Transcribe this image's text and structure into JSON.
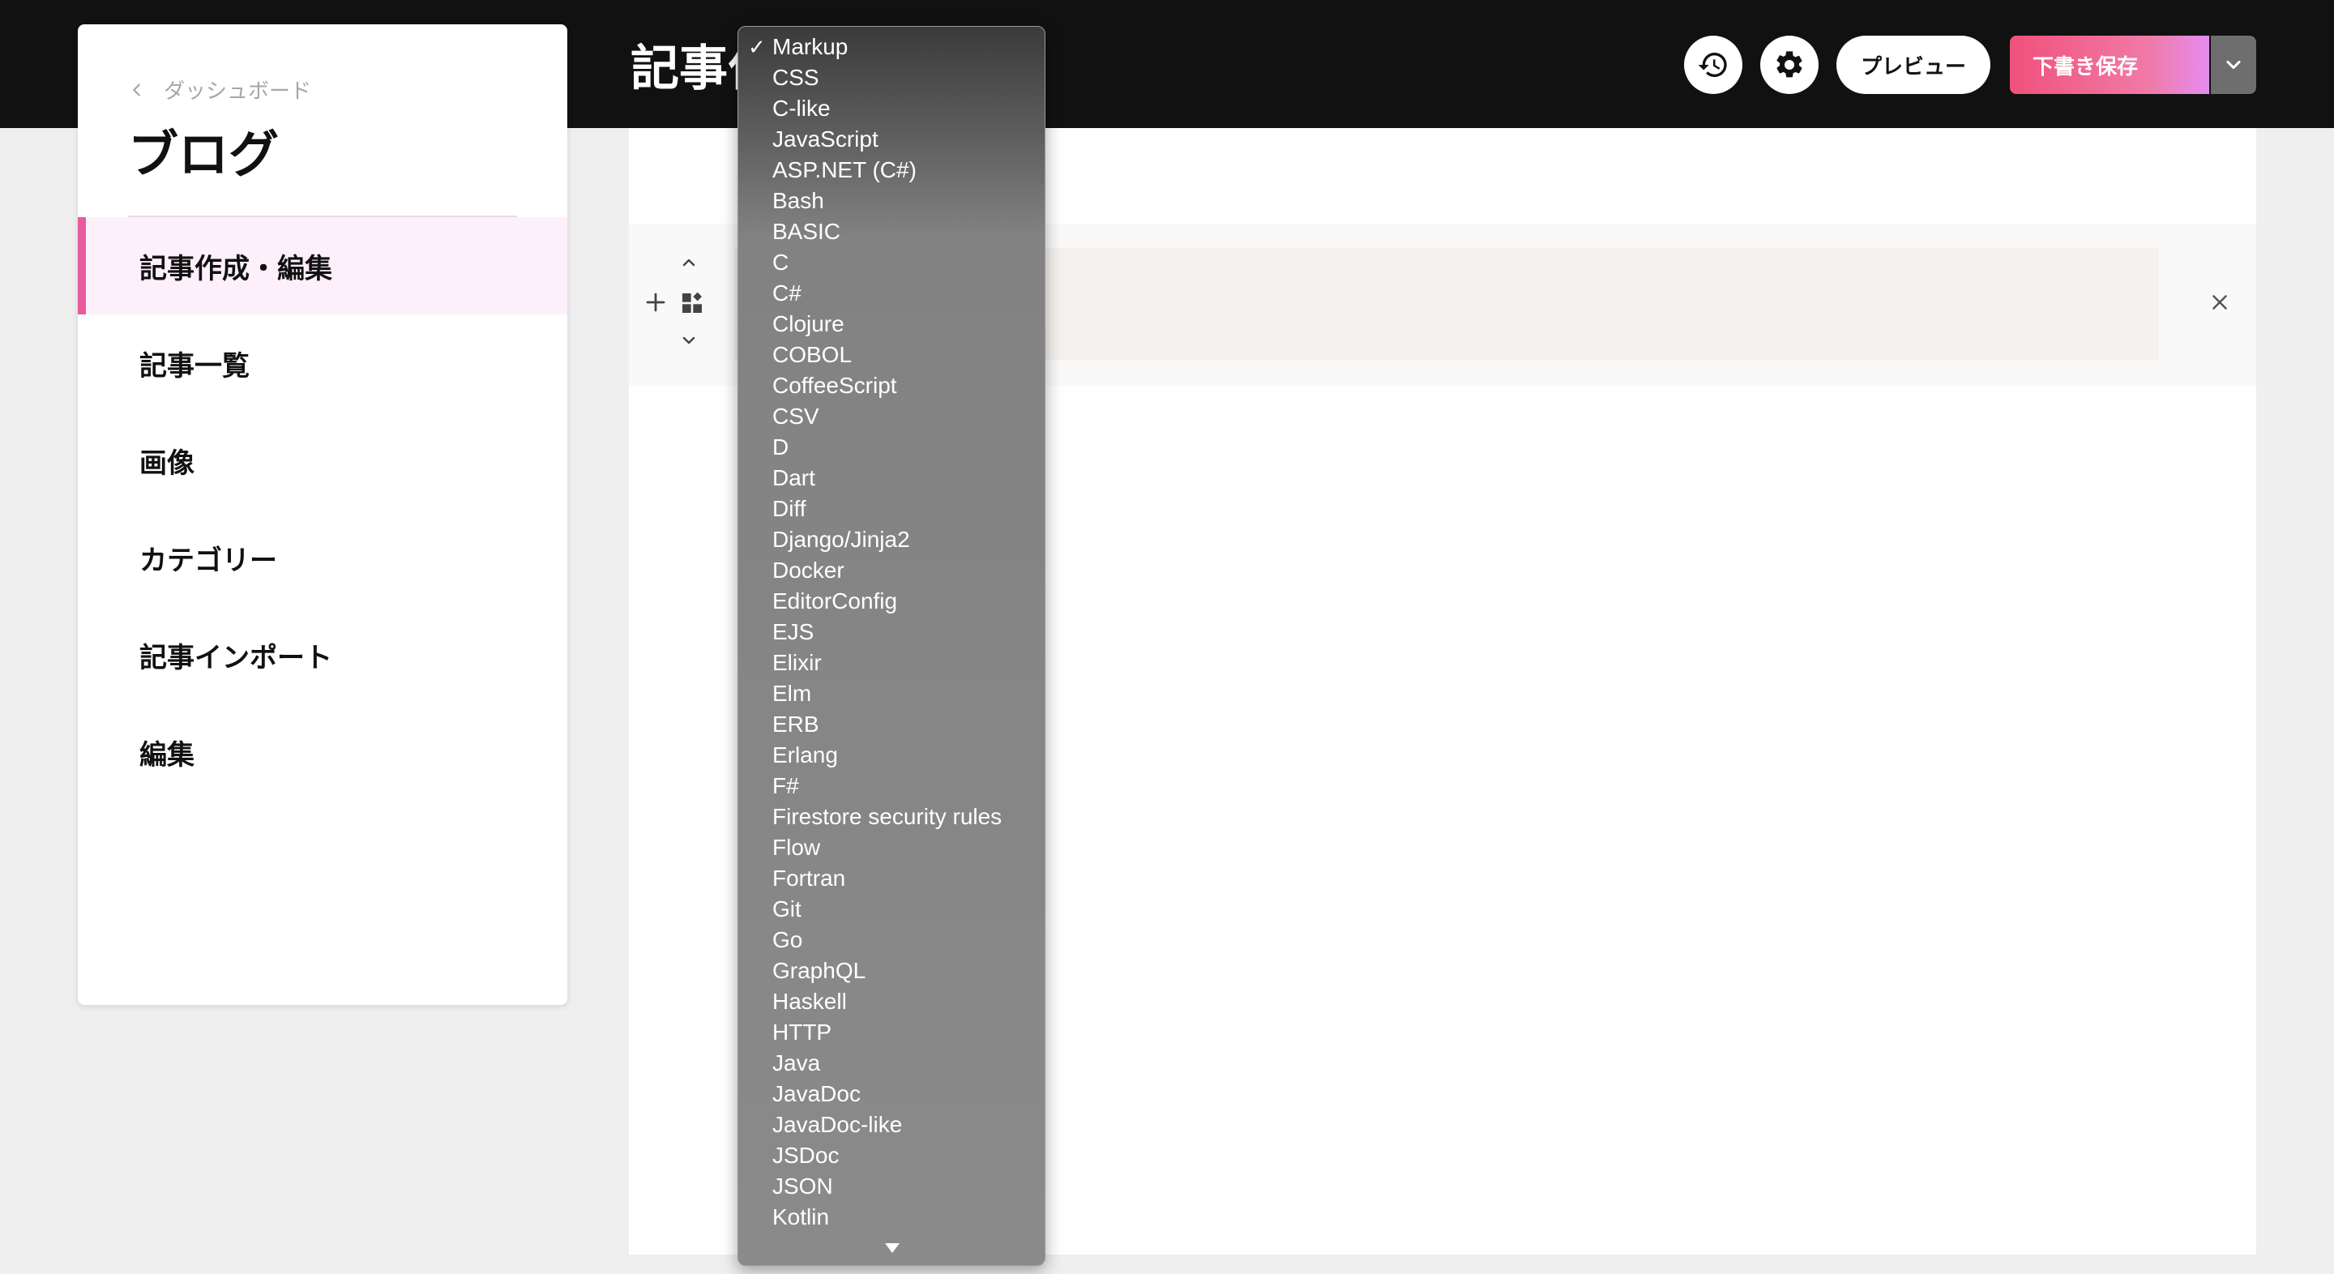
{
  "header": {
    "page_title": "記事作成・編集",
    "preview_label": "プレビュー",
    "save_label": "下書き保存",
    "icons": {
      "history": "history-icon",
      "settings": "gear-icon",
      "caret": "chevron-down-icon"
    }
  },
  "sidebar": {
    "back_label": "ダッシュボード",
    "title": "ブログ",
    "items": [
      {
        "label": "記事作成・編集",
        "active": true
      },
      {
        "label": "記事一覧"
      },
      {
        "label": "画像"
      },
      {
        "label": "カテゴリー"
      },
      {
        "label": "記事インポート"
      },
      {
        "label": "編集"
      }
    ]
  },
  "editor": {
    "block_tools": [
      "add-block-icon",
      "block-type-icon",
      "move-up-icon",
      "move-down-icon",
      "close-icon"
    ]
  },
  "language_dropdown": {
    "selected": "Markup",
    "check_mark": "✓",
    "options": [
      "Markup",
      "CSS",
      "C-like",
      "JavaScript",
      "ASP.NET (C#)",
      "Bash",
      "BASIC",
      "C",
      "C#",
      "Clojure",
      "COBOL",
      "CoffeeScript",
      "CSV",
      "D",
      "Dart",
      "Diff",
      "Django/Jinja2",
      "Docker",
      "EditorConfig",
      "EJS",
      "Elixir",
      "Elm",
      "ERB",
      "Erlang",
      "F#",
      "Firestore security rules",
      "Flow",
      "Fortran",
      "Git",
      "Go",
      "GraphQL",
      "Haskell",
      "HTTP",
      "Java",
      "JavaDoc",
      "JavaDoc-like",
      "JSDoc",
      "JSON",
      "Kotlin"
    ]
  },
  "colors": {
    "topbar": "#111111",
    "accent_active": "#ea5a9e",
    "save_gradient_start": "#f0517a",
    "save_gradient_end": "#e58cf0"
  }
}
